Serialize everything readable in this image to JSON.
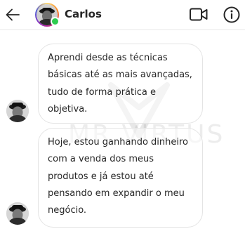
{
  "header": {
    "contact_name": "Carlos",
    "back_icon": "arrow-left-icon",
    "video_icon": "video-camera-icon",
    "info_icon": "info-icon",
    "online_status_color": "#2ecc4f"
  },
  "chat": {
    "watermark": "MR VIRTUS",
    "messages": [
      {
        "text": "Aprendi desde as técnicas\nbásicas até as mais avançadas,\ntudo de forma prática e\nobjetiva."
      },
      {
        "text": "Hoje, estou ganhando dinheiro\ncom a venda dos meus\nprodutos e já estou até\npensando em expandir o meu\nnegócio."
      }
    ]
  }
}
